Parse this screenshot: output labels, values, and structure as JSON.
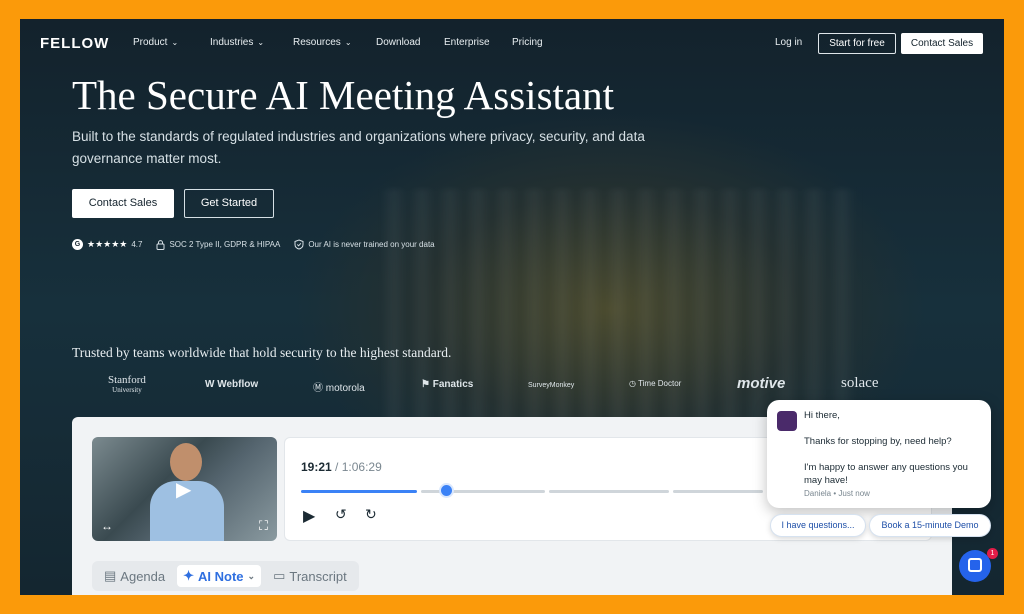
{
  "nav": {
    "logo": "FELLOW",
    "items": [
      {
        "label": "Product",
        "dropdown": true
      },
      {
        "label": "Industries",
        "dropdown": true
      },
      {
        "label": "Resources",
        "dropdown": true
      },
      {
        "label": "Download",
        "dropdown": false
      },
      {
        "label": "Enterprise",
        "dropdown": false
      },
      {
        "label": "Pricing",
        "dropdown": false
      }
    ],
    "login": "Log in",
    "start_free": "Start for free",
    "contact_sales": "Contact Sales"
  },
  "hero": {
    "title": "The Secure AI Meeting Assistant",
    "subtitle": "Built to the standards of regulated industries and organizations where privacy, security, and data governance matter most.",
    "primary_button": "Contact Sales",
    "secondary_button": "Get Started",
    "rating_icon_letter": "G",
    "rating_stars": "★★★★★",
    "rating": "4.7",
    "compliance": "SOC 2 Type II, GDPR & HIPAA",
    "ai_note": "Our AI is never trained on your data"
  },
  "trusted": {
    "text": "Trusted by teams worldwide that hold security to the highest standard.",
    "logos": [
      "Stanford",
      "University",
      "Webflow",
      "motorola",
      "Fanatics",
      "SurveyMonkey",
      "Time Doctor",
      "motive",
      "solace"
    ]
  },
  "player": {
    "current_time": "19:21",
    "separator": "/",
    "total_time": "1:06:29",
    "progress": 0.29
  },
  "tabs": [
    {
      "label": "Agenda",
      "icon": "calendar-icon"
    },
    {
      "label": "AI Note",
      "icon": "sparkle-icon",
      "active": true
    },
    {
      "label": "Transcript",
      "icon": "chat-icon"
    }
  ],
  "chat": {
    "greeting": "Hi there,",
    "line1": "Thanks for stopping by, need help?",
    "line2": "I'm happy to answer any questions you may have!",
    "meta": "Daniela • Just now",
    "quick_reply_1": "I have questions...",
    "quick_reply_2": "Book a 15-minute Demo",
    "notification_count": "1"
  },
  "colors": {
    "frame_orange": "#fb9a0a",
    "hero_bg": "#13222c",
    "accent_blue": "#3b82f6"
  }
}
